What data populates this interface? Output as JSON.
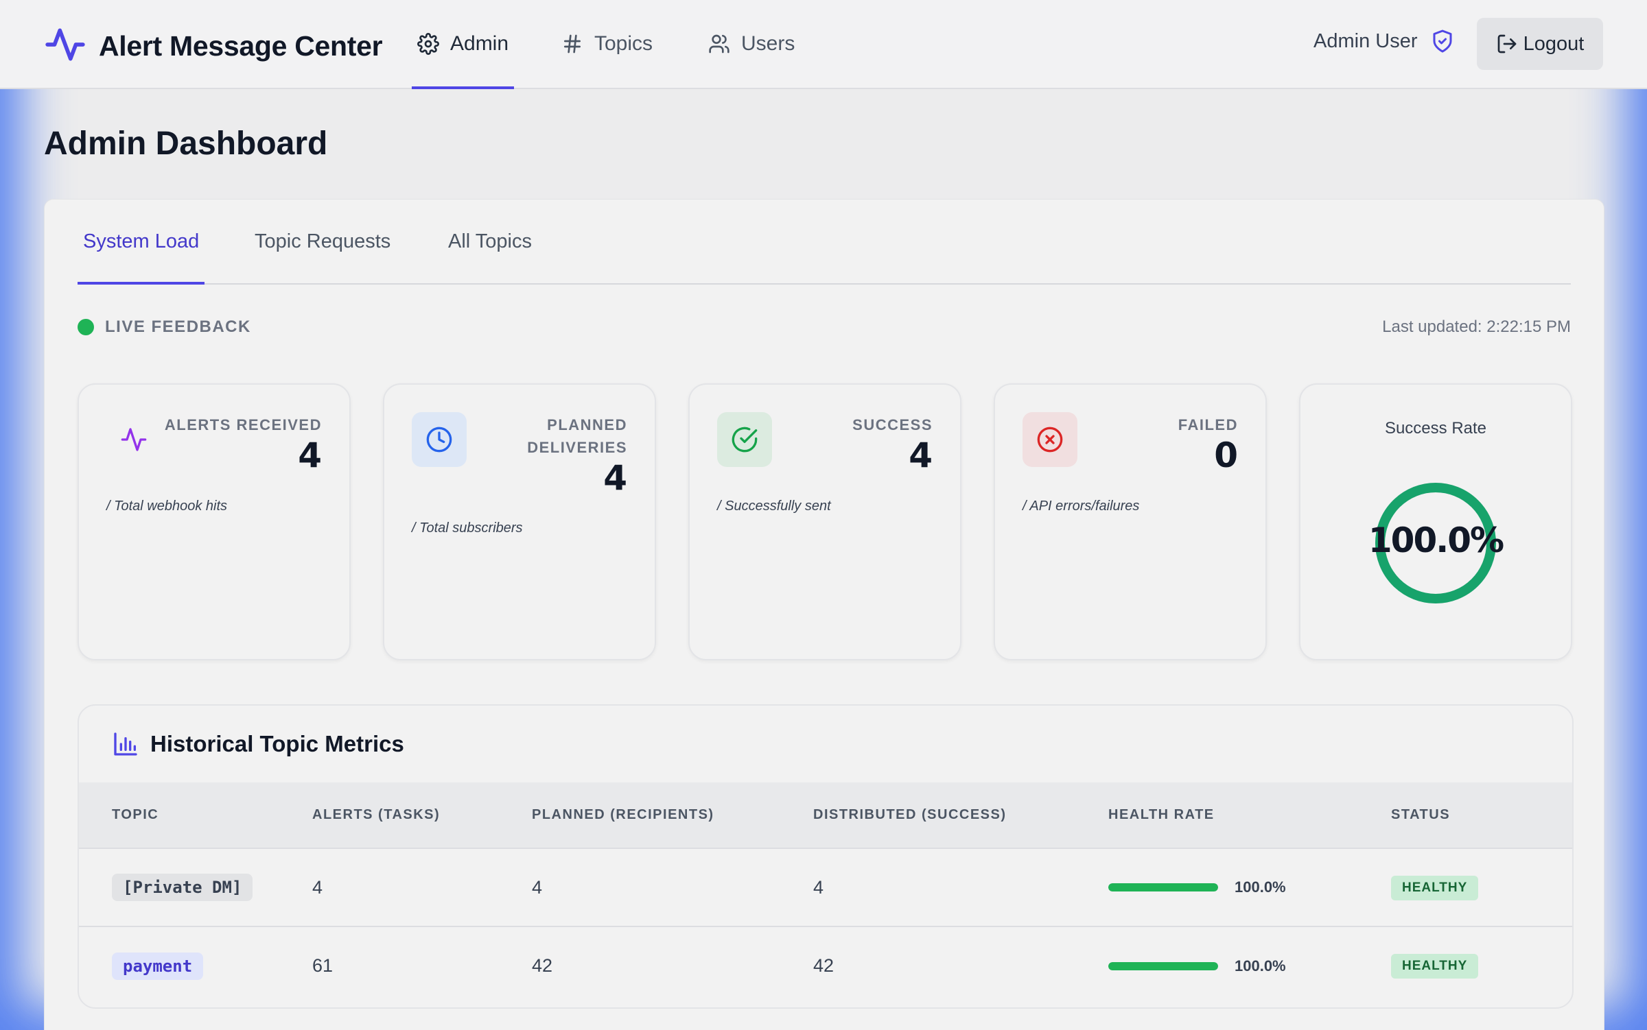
{
  "app": {
    "title": "Alert Message Center",
    "accent_color": "#4f46e5"
  },
  "nav": {
    "items": [
      {
        "label": "Admin",
        "icon": "gear-icon",
        "active": true
      },
      {
        "label": "Topics",
        "icon": "hash-icon",
        "active": false
      },
      {
        "label": "Users",
        "icon": "users-icon",
        "active": false
      }
    ]
  },
  "user": {
    "name": "Admin User",
    "icon": "shield-check-icon",
    "logout_label": "Logout"
  },
  "page": {
    "title": "Admin Dashboard"
  },
  "tabs": [
    {
      "label": "System Load",
      "active": true
    },
    {
      "label": "Topic Requests",
      "active": false
    },
    {
      "label": "All Topics",
      "active": false
    }
  ],
  "status": {
    "live_label": "LIVE FEEDBACK",
    "live_color": "#1fb356",
    "last_updated": "Last updated: 2:22:15 PM"
  },
  "cards": [
    {
      "label": "ALERTS RECEIVED",
      "value": "4",
      "sub": "/ Total webhook hits",
      "icon": "activity-icon",
      "color": "#9333ea"
    },
    {
      "label": "PLANNED DELIVERIES",
      "value": "4",
      "sub": "/ Total subscribers",
      "icon": "clock-icon",
      "color": "#2563eb"
    },
    {
      "label": "SUCCESS",
      "value": "4",
      "sub": "/ Successfully sent",
      "icon": "check-circle-icon",
      "color": "#16a34a"
    },
    {
      "label": "FAILED",
      "value": "0",
      "sub": "/ API errors/failures",
      "icon": "x-circle-icon",
      "color": "#dc2626"
    }
  ],
  "success_rate": {
    "label": "Success Rate",
    "value": "100.0%",
    "fraction": 1.0,
    "color": "#17a36b"
  },
  "metrics": {
    "title": "Historical Topic Metrics",
    "icon": "bar-chart-icon",
    "columns": [
      "TOPIC",
      "ALERTS (TASKS)",
      "PLANNED (RECIPIENTS)",
      "DISTRIBUTED (SUCCESS)",
      "HEALTH RATE",
      "STATUS"
    ],
    "rows": [
      {
        "topic": "[Private DM]",
        "alerts": "4",
        "planned": "4",
        "distributed": "4",
        "health": "100.0%",
        "health_fraction": 1.0,
        "status": "HEALTHY"
      },
      {
        "topic": "payment",
        "alerts": "61",
        "planned": "42",
        "distributed": "42",
        "health": "100.0%",
        "health_fraction": 1.0,
        "status": "HEALTHY"
      }
    ]
  }
}
